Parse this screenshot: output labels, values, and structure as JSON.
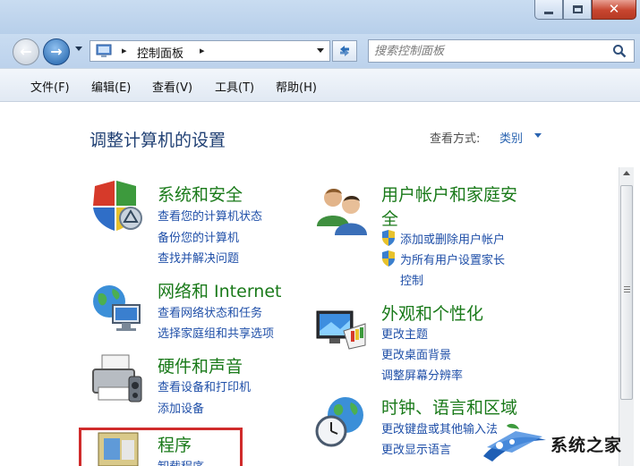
{
  "window": {
    "minimize_glyph": "minimize-icon",
    "maximize_glyph": "maximize-icon",
    "close_glyph": "✕"
  },
  "nav": {
    "back_glyph": "←",
    "forward_glyph": "→",
    "breadcrumb_sep": "▸",
    "address_text": "控制面板",
    "search_placeholder": "搜索控制面板"
  },
  "menubar": {
    "items": [
      "文件(F)",
      "编辑(E)",
      "查看(V)",
      "工具(T)",
      "帮助(H)"
    ]
  },
  "main": {
    "title": "调整计算机的设置",
    "view_by_label": "查看方式:",
    "view_by_value": "类别"
  },
  "categories": [
    {
      "title": "系统和安全",
      "icon": "shield-icon",
      "links": [
        "查看您的计算机状态",
        "备份您的计算机",
        "查找并解决问题"
      ]
    },
    {
      "title": "网络和 Internet",
      "icon": "network-globe-icon",
      "links": [
        "查看网络状态和任务",
        "选择家庭组和共享选项"
      ]
    },
    {
      "title": "硬件和声音",
      "icon": "printer-icon",
      "links": [
        "查看设备和打印机",
        "添加设备"
      ]
    },
    {
      "title": "程序",
      "icon": "programs-icon",
      "links": [
        "卸载程序"
      ]
    },
    {
      "title_line1": "用户帐户和家庭安",
      "title_line2": "全",
      "icon": "users-icon",
      "links": [
        "添加或删除用户帐户",
        "为所有用户设置家长",
        "控制"
      ]
    },
    {
      "title": "外观和个性化",
      "icon": "monitor-icon",
      "links": [
        "更改主题",
        "更改桌面背景",
        "调整屏幕分辨率"
      ]
    },
    {
      "title": "时钟、语言和区域",
      "icon": "clock-globe-icon",
      "links": [
        "更改键盘或其他输入法",
        "更改显示语言"
      ]
    }
  ],
  "watermark": {
    "text": "系统之家"
  },
  "colors": {
    "category_title": "#1a7a1a",
    "link": "#1f4fa8",
    "page_title": "#1f3f73",
    "highlight": "#d02b2b"
  }
}
